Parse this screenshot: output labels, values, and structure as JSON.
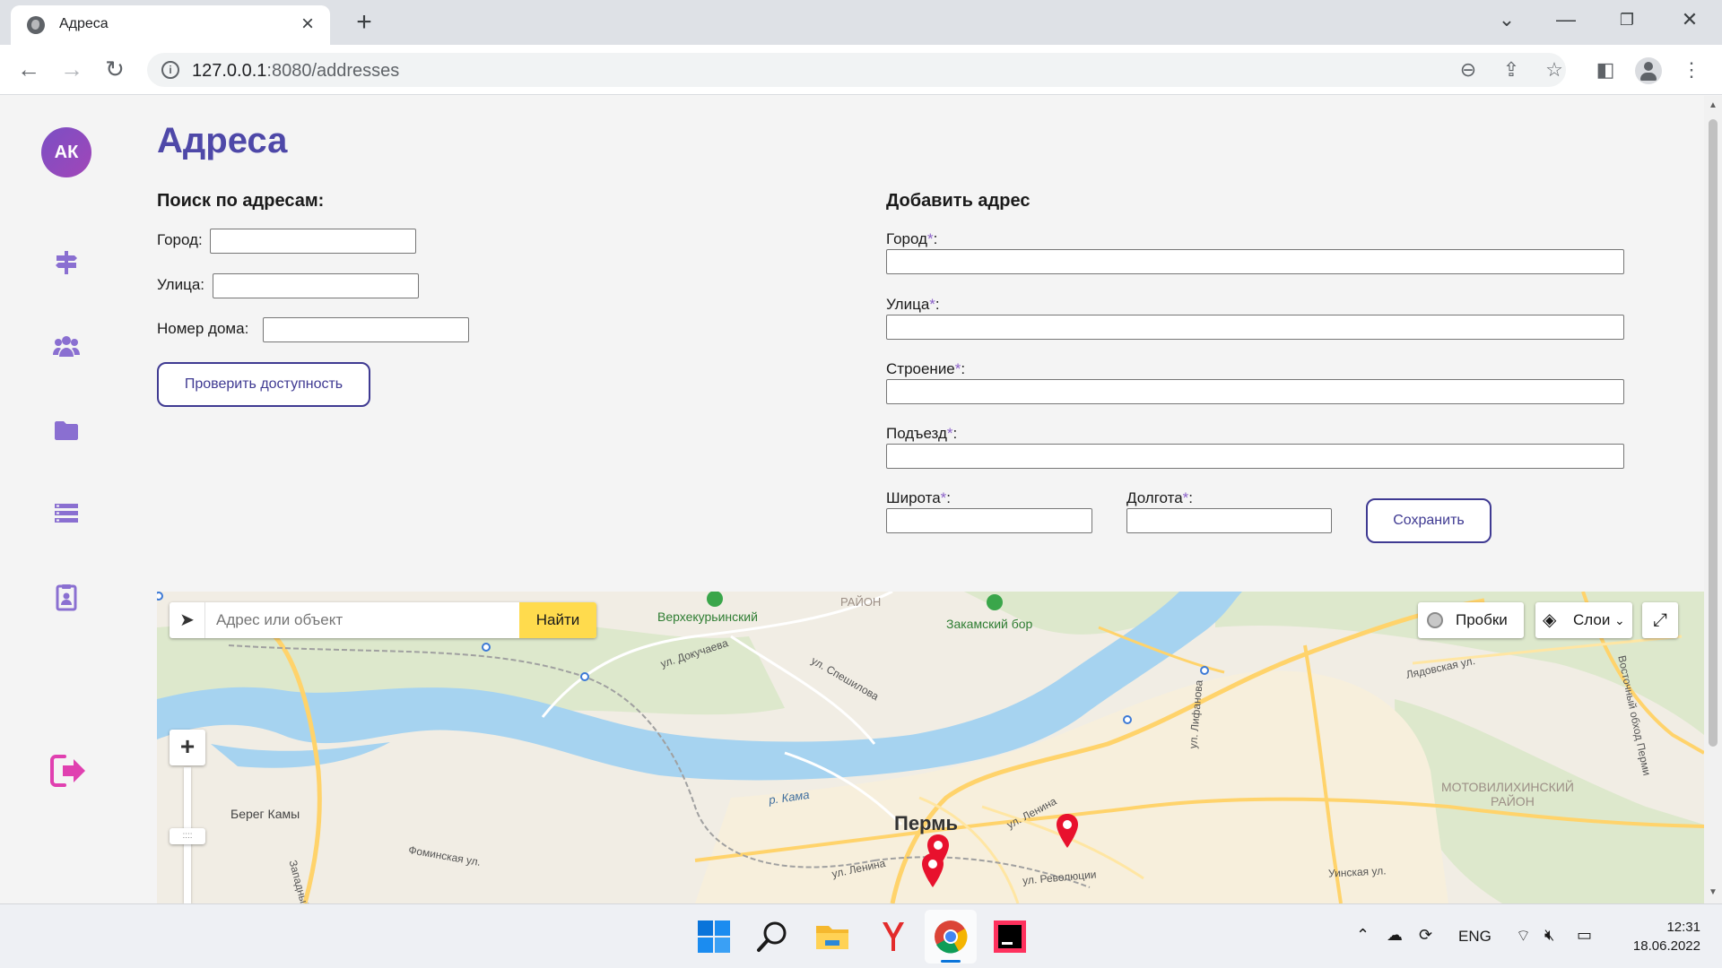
{
  "browser": {
    "tab_title": "Адреса",
    "url_host": "127.0.0.1",
    "url_path": ":8080/addresses"
  },
  "sidebar": {
    "avatar_initials": "АК",
    "items": [
      {
        "icon": "signpost-icon"
      },
      {
        "icon": "users-icon"
      },
      {
        "icon": "folder-icon"
      },
      {
        "icon": "list-icon"
      },
      {
        "icon": "clipboard-user-icon"
      }
    ],
    "logout_icon": "logout-icon"
  },
  "page": {
    "title": "Адреса"
  },
  "search": {
    "title": "Поиск по адресам:",
    "city_label": "Город:",
    "street_label": "Улица:",
    "house_label": "Номер дома:",
    "city_value": "",
    "street_value": "",
    "house_value": "",
    "check_button": "Проверить доступность"
  },
  "add": {
    "title": "Добавить адрес",
    "city_label": "Город",
    "street_label": "Улица",
    "building_label": "Строение",
    "entrance_label": "Подъезд",
    "lat_label": "Широта",
    "lon_label": "Долгота",
    "required_mark": "*",
    "colon": ":",
    "save_button": "Сохранить"
  },
  "map": {
    "search_placeholder": "Адрес или объект",
    "find_button": "Найти",
    "traffic_button": "Пробки",
    "layers_button": "Слои",
    "zoom_in": "+",
    "labels": {
      "verkhnekurinsky": "Верхекурьинский",
      "rayon_top": "РАЙОН",
      "zakamsky_bor": "Закамский бор",
      "dokuchaeva": "ул. Докучаева",
      "speshilova": "ул. Спешилова",
      "lyadovskaya": "Лядовская ул.",
      "lifanova": "ул. Лифанова",
      "obkhod": "Восточный обход Перми",
      "motovilikha": "МОТОВИЛИХИНСКИЙ",
      "rayon_motov": "РАЙОН",
      "kama": "р. Кама",
      "bereg": "Берег Камы",
      "perm": "Пермь",
      "lenina1": "ул. Ленина",
      "lenina2": "ул. Ленина",
      "revolyutsii": "ул. Революции",
      "uinskaya": "Уинская ул.",
      "fominskaya": "Фоминская ул.",
      "zapadny": "Западный"
    },
    "colors": {
      "water": "#a6d3f0",
      "land": "#f1ede4",
      "forest": "#d6e9c6",
      "road_major": "#ffd36b",
      "pin": "#e8112d"
    }
  },
  "taskbar": {
    "lang": "ENG",
    "time": "12:31",
    "date": "18.06.2022"
  }
}
